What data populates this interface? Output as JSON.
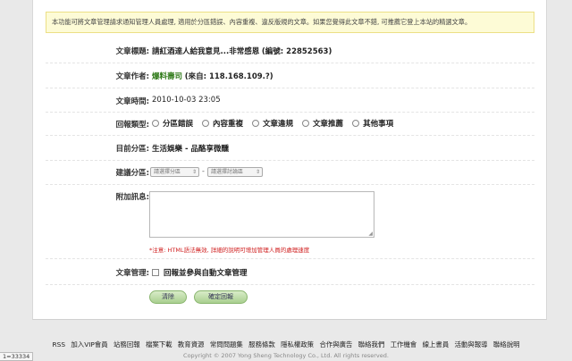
{
  "notice": "本功能可將文章管理請求通知管理人員處理, 適用於分區錯誤、內容重複、違反版規的文章。如果您覺得此文章不錯, 可推薦它登上本站的精選文章。",
  "fields": {
    "title": {
      "label": "文章標題:",
      "value": "請紅酒達人給我意見...非常感恩",
      "extra": "(編號: 22852563)"
    },
    "author": {
      "label": "文章作者:",
      "value": "爆料壽司",
      "extra": "(來自: 118.168.109.?)"
    },
    "time": {
      "label": "文章時間:",
      "value": "2010-10-03 23:05"
    },
    "type": {
      "label": "回報類型:",
      "options": [
        "分區錯誤",
        "內容重複",
        "文章違規",
        "文章推薦",
        "其他事項"
      ]
    },
    "current_section": {
      "label": "目前分區:",
      "value": "生活娛樂 - 品酪享微醺"
    },
    "suggest_section": {
      "label": "建議分區:",
      "select1": "請選擇分區",
      "dash": "-",
      "select2": "請選擇討論區"
    },
    "message": {
      "label": "附加訊息:",
      "hint": "*注意: HTML語法無效, 詳細的說明可增加管理人員的處理速度"
    },
    "manage": {
      "label": "文章管理:",
      "checkbox_label": "回報並參與自動文章管理"
    }
  },
  "buttons": {
    "clear": "清除",
    "submit": "確定回報"
  },
  "footer": {
    "links": [
      "RSS",
      "加入VIP會員",
      "站務回報",
      "檔案下載",
      "教育資源",
      "常問問題集",
      "服務條款",
      "隱私權政策",
      "合作與廣告",
      "聯絡我們",
      "工作機會",
      "線上書員",
      "活動與報導",
      "聯絡說明"
    ],
    "copyright": "Copyright © 2007 Yong Sheng Technology Co., Ltd. All rights reserved."
  },
  "corner_id": "1=33334"
}
